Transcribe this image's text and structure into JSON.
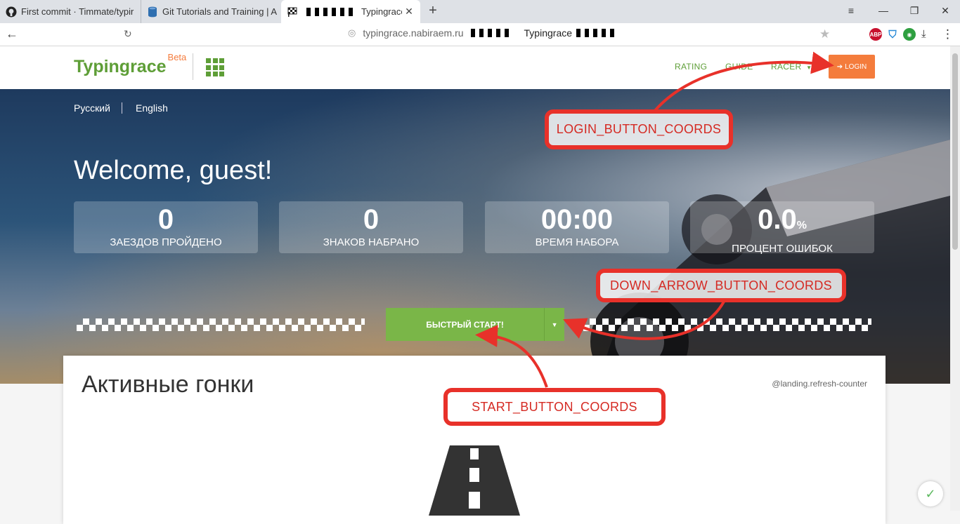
{
  "browser": {
    "tabs": [
      {
        "title": "First commit · Timmate/typir",
        "icon": "github-icon"
      },
      {
        "title": "Git Tutorials and Training | A",
        "icon": "database-icon"
      },
      {
        "title": "Typingrace",
        "icon": "checkered-flag-icon",
        "active": true
      }
    ],
    "new_tab": "+",
    "url": "typingrace.nabiraem.ru",
    "page_title": "Typingrace",
    "extensions": [
      "ABP",
      "shield",
      "green"
    ]
  },
  "header": {
    "logo": "Typingrace",
    "logo_sup": "Beta",
    "nav": [
      "RATING",
      "GUIDE",
      "RACER"
    ],
    "login": "LOGIN"
  },
  "hero": {
    "lang_ru": "Русский",
    "lang_en": "English",
    "welcome": "Welcome, guest!",
    "stats": [
      {
        "value": "0",
        "label": "ЗАЕЗДОВ ПРОЙДЕНО"
      },
      {
        "value": "0",
        "label": "ЗНАКОВ НАБРАНО"
      },
      {
        "value": "00:00",
        "label": "ВРЕМЯ НАБОРА"
      },
      {
        "value": "0.0",
        "suffix": "%",
        "label": "ПРОЦЕНТ ОШИБОК"
      }
    ],
    "start_button": "БЫСТРЫЙ СТАРТ!"
  },
  "card": {
    "title": "Активные гонки",
    "refresh": "@landing.refresh-counter"
  },
  "annotations": {
    "login": "LOGIN_BUTTON_COORDS",
    "down_arrow": "DOWN_ARROW_BUTTON_COORDS",
    "start": "START_BUTTON_COORDS"
  },
  "colors": {
    "brand_green": "#5e9e37",
    "login_orange": "#f47c3c",
    "start_green": "#7ab648",
    "annotation_red": "#e8312a"
  }
}
